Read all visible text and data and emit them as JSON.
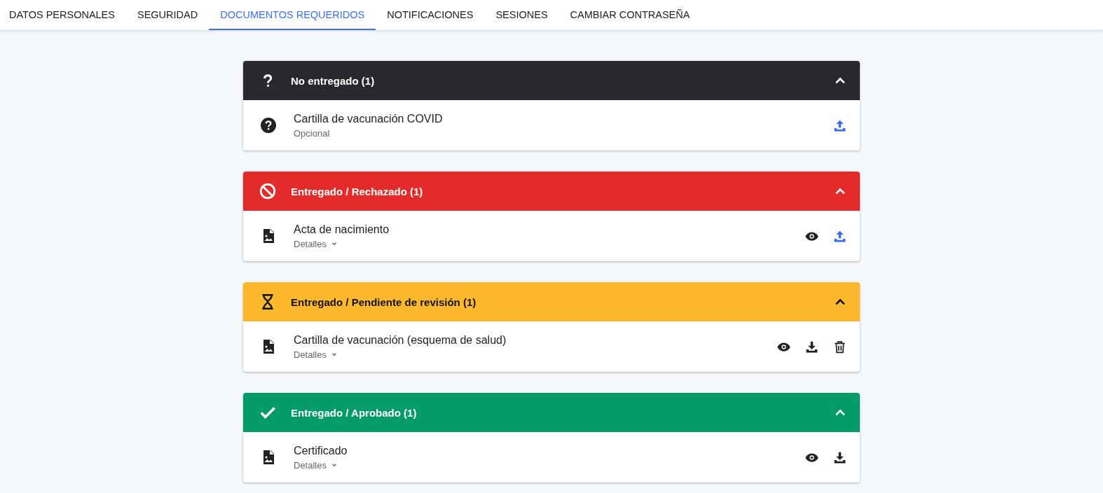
{
  "tabs": [
    {
      "label": "DATOS PERSONALES",
      "selected": false
    },
    {
      "label": "SEGURIDAD",
      "selected": false
    },
    {
      "label": "DOCUMENTOS REQUERIDOS",
      "selected": true
    },
    {
      "label": "NOTIFICACIONES",
      "selected": false
    },
    {
      "label": "SESIONES",
      "selected": false
    },
    {
      "label": "CAMBIAR CONTRASEÑA",
      "selected": false
    }
  ],
  "groups": [
    {
      "kind": "missing",
      "title": "No entregado (1)",
      "color": "#28292e",
      "expanded": true,
      "items": [
        {
          "kind": "optional",
          "name": "Cartilla de vacunación COVID",
          "subtitle": "Opcional",
          "actions": [
            {
              "kind": "upload"
            }
          ]
        }
      ]
    },
    {
      "kind": "rejected",
      "title": "Entregado / Rechazado (1)",
      "color": "#e52a2a",
      "expanded": true,
      "items": [
        {
          "kind": "document",
          "name": "Acta de nacimiento",
          "subtitle": "Detalles",
          "actions": [
            {
              "kind": "view"
            },
            {
              "kind": "upload"
            }
          ]
        }
      ]
    },
    {
      "kind": "pending",
      "title": "Entregado / Pendiente de revisión (1)",
      "color": "#fdb92b",
      "expanded": true,
      "items": [
        {
          "kind": "document",
          "name": "Cartilla de vacunación (esquema de salud)",
          "subtitle": "Detalles",
          "actions": [
            {
              "kind": "view"
            },
            {
              "kind": "download"
            },
            {
              "kind": "delete"
            }
          ]
        }
      ]
    },
    {
      "kind": "approved",
      "title": "Entregado / Aprobado (1)",
      "color": "#039b68",
      "expanded": true,
      "items": [
        {
          "kind": "document",
          "name": "Certificado",
          "subtitle": "Detalles",
          "actions": [
            {
              "kind": "view"
            },
            {
              "kind": "download"
            }
          ]
        }
      ]
    }
  ]
}
